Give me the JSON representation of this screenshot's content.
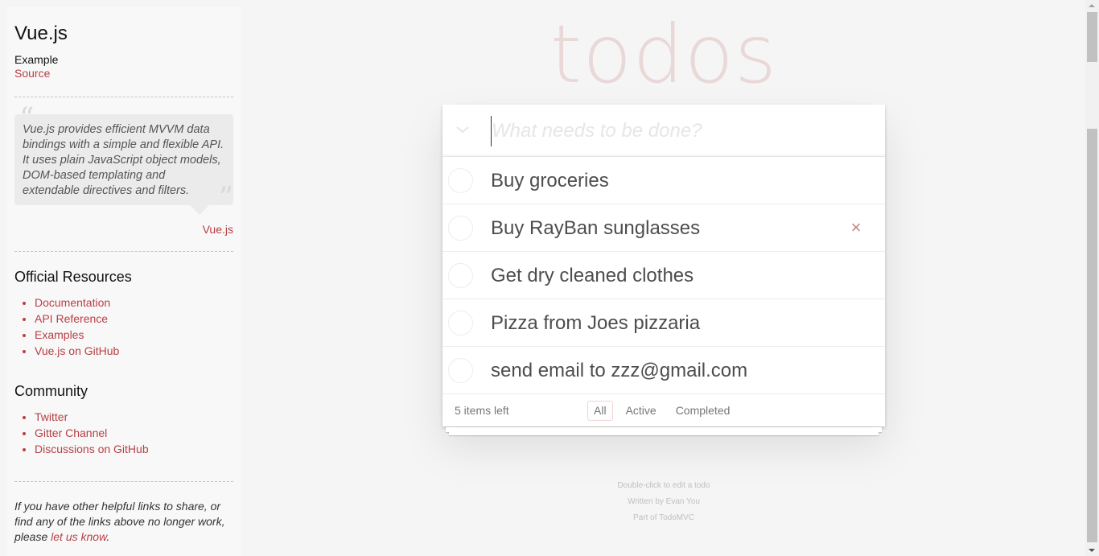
{
  "sidebar": {
    "title": "Vue.js",
    "subtitle": "Example",
    "source_link": "Source",
    "quote": "Vue.js provides efficient MVVM data bindings with a simple and flexible API. It uses plain JavaScript object models, DOM-based templating and extendable directives and filters.",
    "quote_open": "“",
    "quote_close": "”",
    "quote_attribution": "Vue.js",
    "resources_heading": "Official Resources",
    "resources": [
      "Documentation",
      "API Reference",
      "Examples",
      "Vue.js on GitHub"
    ],
    "community_heading": "Community",
    "community": [
      "Twitter",
      "Gitter Channel",
      "Discussions on GitHub"
    ],
    "note_prefix": "If you have other helpful links to share, or find any of the links above no longer work, please ",
    "note_link": "let us know",
    "note_suffix": "."
  },
  "app": {
    "title": "todos",
    "new_todo_placeholder": "What needs to be done?",
    "toggle_all_icon": "chevron-down-icon",
    "todos": [
      {
        "label": "Buy groceries",
        "completed": false
      },
      {
        "label": "Buy RayBan sunglasses",
        "completed": false,
        "hovered": true
      },
      {
        "label": "Get dry cleaned clothes",
        "completed": false
      },
      {
        "label": "Pizza from Joes pizzaria",
        "completed": false
      },
      {
        "label": "send email to zzz@gmail.com",
        "completed": false
      }
    ],
    "destroy_glyph": "×",
    "items_left": "5 items left",
    "filters": [
      "All",
      "Active",
      "Completed"
    ],
    "selected_filter": "All"
  },
  "info": {
    "line1": "Double-click to edit a todo",
    "line2": "Written by Evan You",
    "line3": "Part of TodoMVC"
  },
  "colors": {
    "accent": "#b83f45",
    "title": "#ead7d7",
    "background": "#f5f5f5"
  }
}
